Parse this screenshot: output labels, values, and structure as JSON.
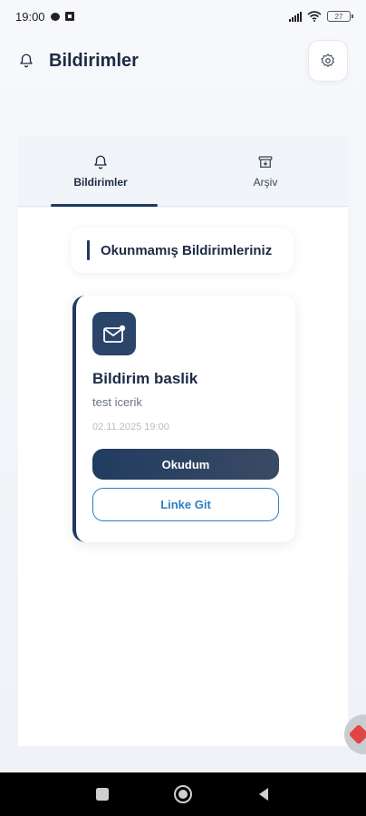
{
  "status_bar": {
    "time": "19:00",
    "battery": "27"
  },
  "header": {
    "title": "Bildirimler",
    "bell_icon": "bell-icon",
    "settings_icon": "gear-icon"
  },
  "tabs": [
    {
      "label": "Bildirimler",
      "icon": "bell-icon",
      "active": true
    },
    {
      "label": "Arşiv",
      "icon": "archive-icon",
      "active": false
    }
  ],
  "section": {
    "title": "Okunmamış Bildirimleriniz"
  },
  "notification": {
    "icon": "mail-icon",
    "title": "Bildirim baslik",
    "body": "test icerik",
    "date": "02.11.2025 19:00",
    "read_label": "Okudum",
    "link_label": "Linke Git"
  },
  "colors": {
    "primary": "#1f3a60",
    "link": "#2d7fc2",
    "background": "#f3f6fa"
  }
}
